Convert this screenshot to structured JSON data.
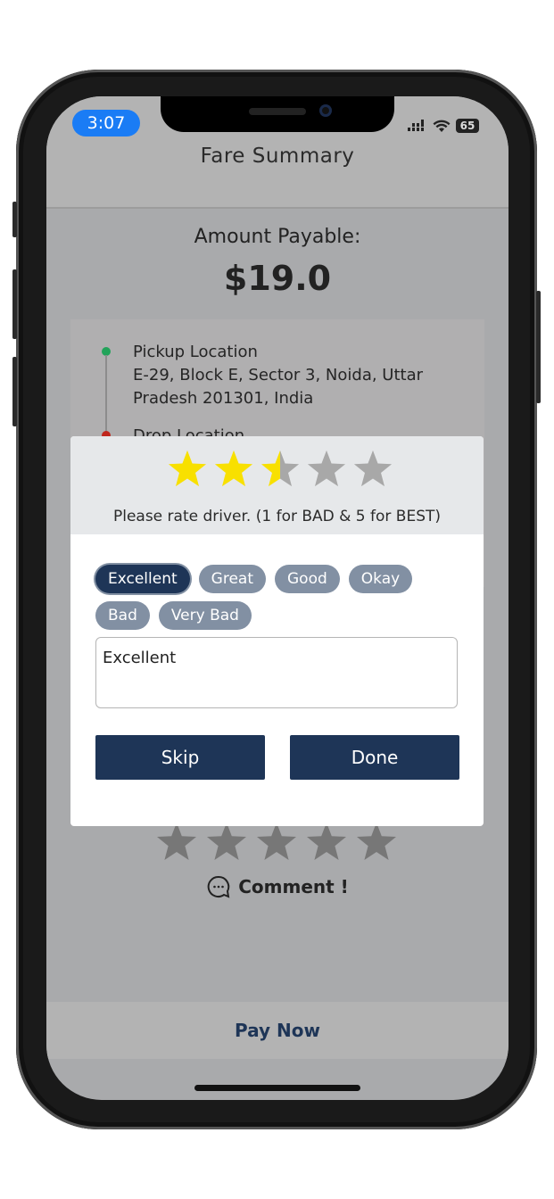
{
  "status_bar": {
    "time": "3:07",
    "battery": "65",
    "icons": [
      "signal-icon",
      "wifi-icon",
      "battery-icon"
    ]
  },
  "header": {
    "title": "Fare Summary"
  },
  "fare": {
    "label": "Amount Payable:",
    "amount": "$19.0"
  },
  "locations": {
    "pickup": {
      "label": "Pickup Location",
      "address": "E-29, Block E, Sector 3, Noida, Uttar Pradesh 201301, India",
      "color": "#22a35a"
    },
    "drop": {
      "label": "Drop Location",
      "color": "#c0261c"
    }
  },
  "background_rating": {
    "value": 0,
    "max": 5
  },
  "comment_link": {
    "label": "Comment !",
    "icon": "chat-bubble-icon"
  },
  "pay_button": {
    "label": "Pay Now"
  },
  "rating_dialog": {
    "rating": 2.5,
    "max": 5,
    "hint": "Please rate driver. (1 for BAD & 5 for BEST)",
    "chips": [
      {
        "label": "Excellent",
        "selected": true
      },
      {
        "label": "Great",
        "selected": false
      },
      {
        "label": "Good",
        "selected": false
      },
      {
        "label": "Okay",
        "selected": false
      },
      {
        "label": "Bad",
        "selected": false
      },
      {
        "label": "Very Bad",
        "selected": false
      }
    ],
    "comment_value": "Excellent",
    "skip_label": "Skip",
    "done_label": "Done",
    "colors": {
      "star_filled": "#f8e000",
      "star_empty": "#a8a8a8",
      "button": "#1e3557",
      "chip": "#8290a3"
    }
  }
}
